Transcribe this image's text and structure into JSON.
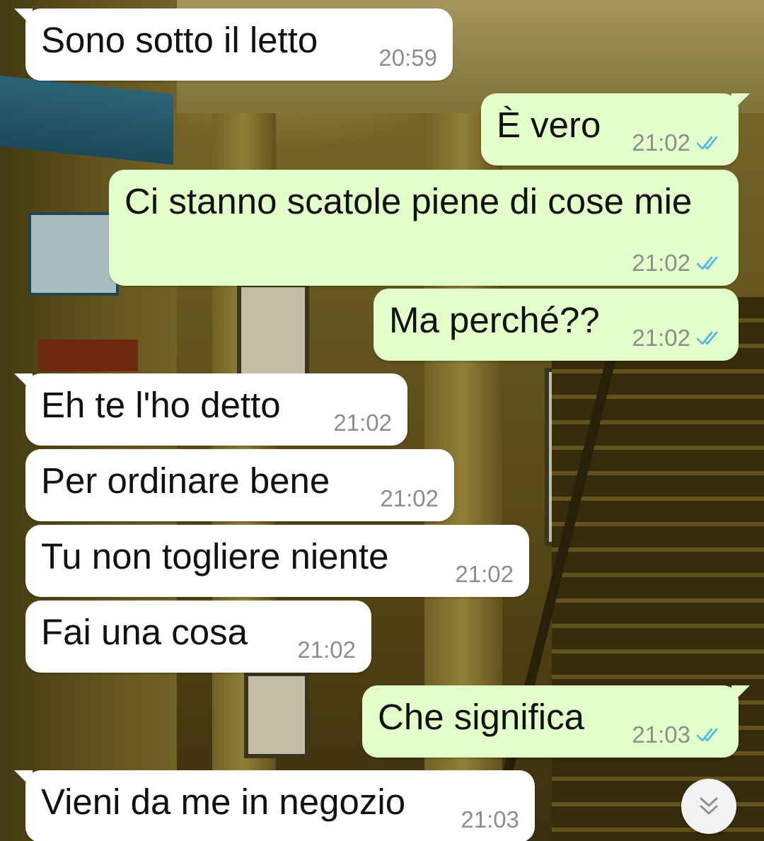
{
  "colors": {
    "incoming_bubble": "#ffffff",
    "outgoing_bubble": "#e3ffca",
    "timestamp": "#8a8f8e",
    "read_ticks": "#4fb6ec"
  },
  "messages": [
    {
      "direction": "in",
      "text": "Sono sotto il letto",
      "time": "20:59"
    },
    {
      "direction": "out",
      "text": "È vero",
      "time": "21:02",
      "status": "read"
    },
    {
      "direction": "out",
      "text": "Ci stanno scatole piene di cose mie",
      "time": "21:02",
      "status": "read"
    },
    {
      "direction": "out",
      "text": "Ma perché??",
      "time": "21:02",
      "status": "read"
    },
    {
      "direction": "in",
      "text": "Eh te l'ho detto",
      "time": "21:02"
    },
    {
      "direction": "in",
      "text": "Per ordinare bene",
      "time": "21:02"
    },
    {
      "direction": "in",
      "text": "Tu non togliere niente",
      "time": "21:02"
    },
    {
      "direction": "in",
      "text": "Fai una cosa",
      "time": "21:02"
    },
    {
      "direction": "out",
      "text": "Che significa",
      "time": "21:03",
      "status": "read"
    },
    {
      "direction": "in",
      "text": "Vieni da me in negozio",
      "time": "21:03"
    }
  ],
  "scroll_button": {
    "icon": "double-chevron-down-icon"
  }
}
